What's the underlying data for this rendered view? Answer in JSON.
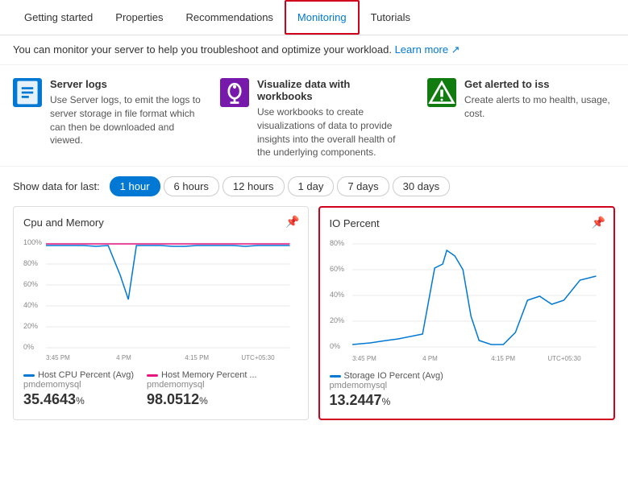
{
  "nav": {
    "items": [
      {
        "label": "Getting started",
        "active": false
      },
      {
        "label": "Properties",
        "active": false
      },
      {
        "label": "Recommendations",
        "active": false
      },
      {
        "label": "Monitoring",
        "active": true
      },
      {
        "label": "Tutorials",
        "active": false
      }
    ]
  },
  "info_bar": {
    "text": "You can monitor your server to help you troubleshoot and optimize your workload.",
    "link_text": "Learn more"
  },
  "features": [
    {
      "id": "server-logs",
      "icon_type": "blue",
      "icon_symbol": "📋",
      "title": "Server logs",
      "description": "Use Server logs, to emit the logs to server storage in file format which can then be downloaded and viewed."
    },
    {
      "id": "workbooks",
      "icon_type": "purple",
      "icon_symbol": "💡",
      "title": "Visualize data with workbooks",
      "description": "Use workbooks to create visualizations of data to provide insights into the overall health of the underlying components."
    },
    {
      "id": "alerts",
      "icon_type": "green",
      "icon_symbol": "❗",
      "title": "Get alerted to iss",
      "description": "Create alerts to mo health, usage, cost."
    }
  ],
  "time_filter": {
    "label": "Show data for last:",
    "options": [
      {
        "label": "1 hour",
        "active": true
      },
      {
        "label": "6 hours",
        "active": false
      },
      {
        "label": "12 hours",
        "active": false
      },
      {
        "label": "1 day",
        "active": false
      },
      {
        "label": "7 days",
        "active": false
      },
      {
        "label": "30 days",
        "active": false
      }
    ]
  },
  "charts": [
    {
      "id": "cpu-memory",
      "title": "Cpu and Memory",
      "highlighted": false,
      "x_labels": [
        "3:45 PM",
        "4 PM",
        "4:15 PM",
        "UTC+05:30"
      ],
      "y_labels": [
        "100%",
        "80%",
        "60%",
        "40%",
        "20%",
        "0%"
      ],
      "legend": [
        {
          "label": "Host CPU Percent (Avg)",
          "sublabel": "pmdemomysql",
          "color": "#0078d4",
          "value": "35.4643",
          "unit": "%"
        },
        {
          "label": "Host Memory Percent ...",
          "sublabel": "pmdemomysql",
          "color": "#e81480",
          "value": "98.0512",
          "unit": "%"
        }
      ]
    },
    {
      "id": "io-percent",
      "title": "IO Percent",
      "highlighted": true,
      "x_labels": [
        "3:45 PM",
        "4 PM",
        "4:15 PM",
        "UTC+05:30"
      ],
      "y_labels": [
        "80%",
        "60%",
        "40%",
        "20%",
        "0%"
      ],
      "legend": [
        {
          "label": "Storage IO Percent (Avg)",
          "sublabel": "pmdemomysql",
          "color": "#0078d4",
          "value": "13.2447",
          "unit": "%"
        }
      ]
    }
  ]
}
